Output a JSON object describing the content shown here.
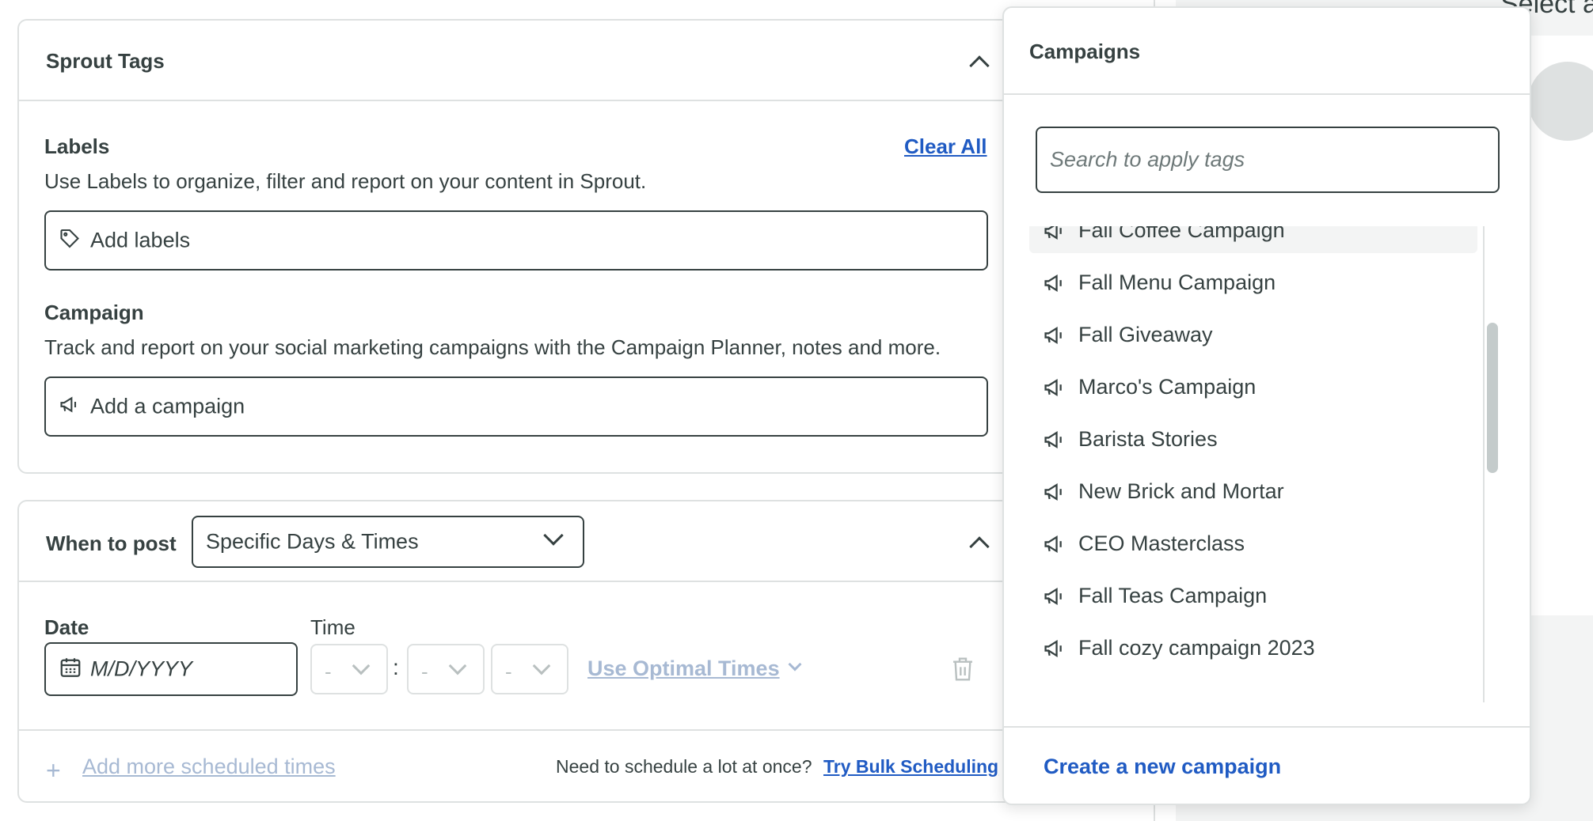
{
  "sprout_tags": {
    "title": "Sprout Tags",
    "labels": {
      "heading": "Labels",
      "clear_all": "Clear All",
      "description": "Use Labels to organize, filter and report on your content in Sprout.",
      "placeholder": "Add labels"
    },
    "campaign": {
      "heading": "Campaign",
      "description": "Track and report on your social marketing campaigns with the Campaign Planner, notes and more.",
      "placeholder": "Add a campaign"
    }
  },
  "when_to_post": {
    "title": "When to post",
    "mode": "Specific Days & Times",
    "date_label": "Date",
    "date_placeholder": "M/D/YYYY",
    "time_label": "Time",
    "hour": "-",
    "colon": ":",
    "minute": "-",
    "ampm": "-",
    "optimal_times": "Use Optimal Times",
    "add_more": "Add more scheduled times",
    "bulk_prompt": "Need to schedule a lot at once?",
    "bulk_link": "Try Bulk Scheduling"
  },
  "background": {
    "header_text": "Select a"
  },
  "campaigns_popover": {
    "title": "Campaigns",
    "search_placeholder": "Search to apply tags",
    "items": [
      "Fall Coffee Campaign",
      "Fall Menu Campaign",
      "Fall Giveaway",
      "Marco's Campaign",
      "Barista Stories",
      "New Brick and Mortar",
      "CEO Masterclass",
      "Fall Teas Campaign",
      "Fall cozy campaign 2023"
    ],
    "highlighted_index": 0,
    "create_link": "Create a new campaign"
  },
  "colors": {
    "text": "#364141",
    "link": "#205bc3",
    "muted_link": "#a7b9d3",
    "border": "#dee1e1",
    "hover": "#f3f4f4"
  }
}
